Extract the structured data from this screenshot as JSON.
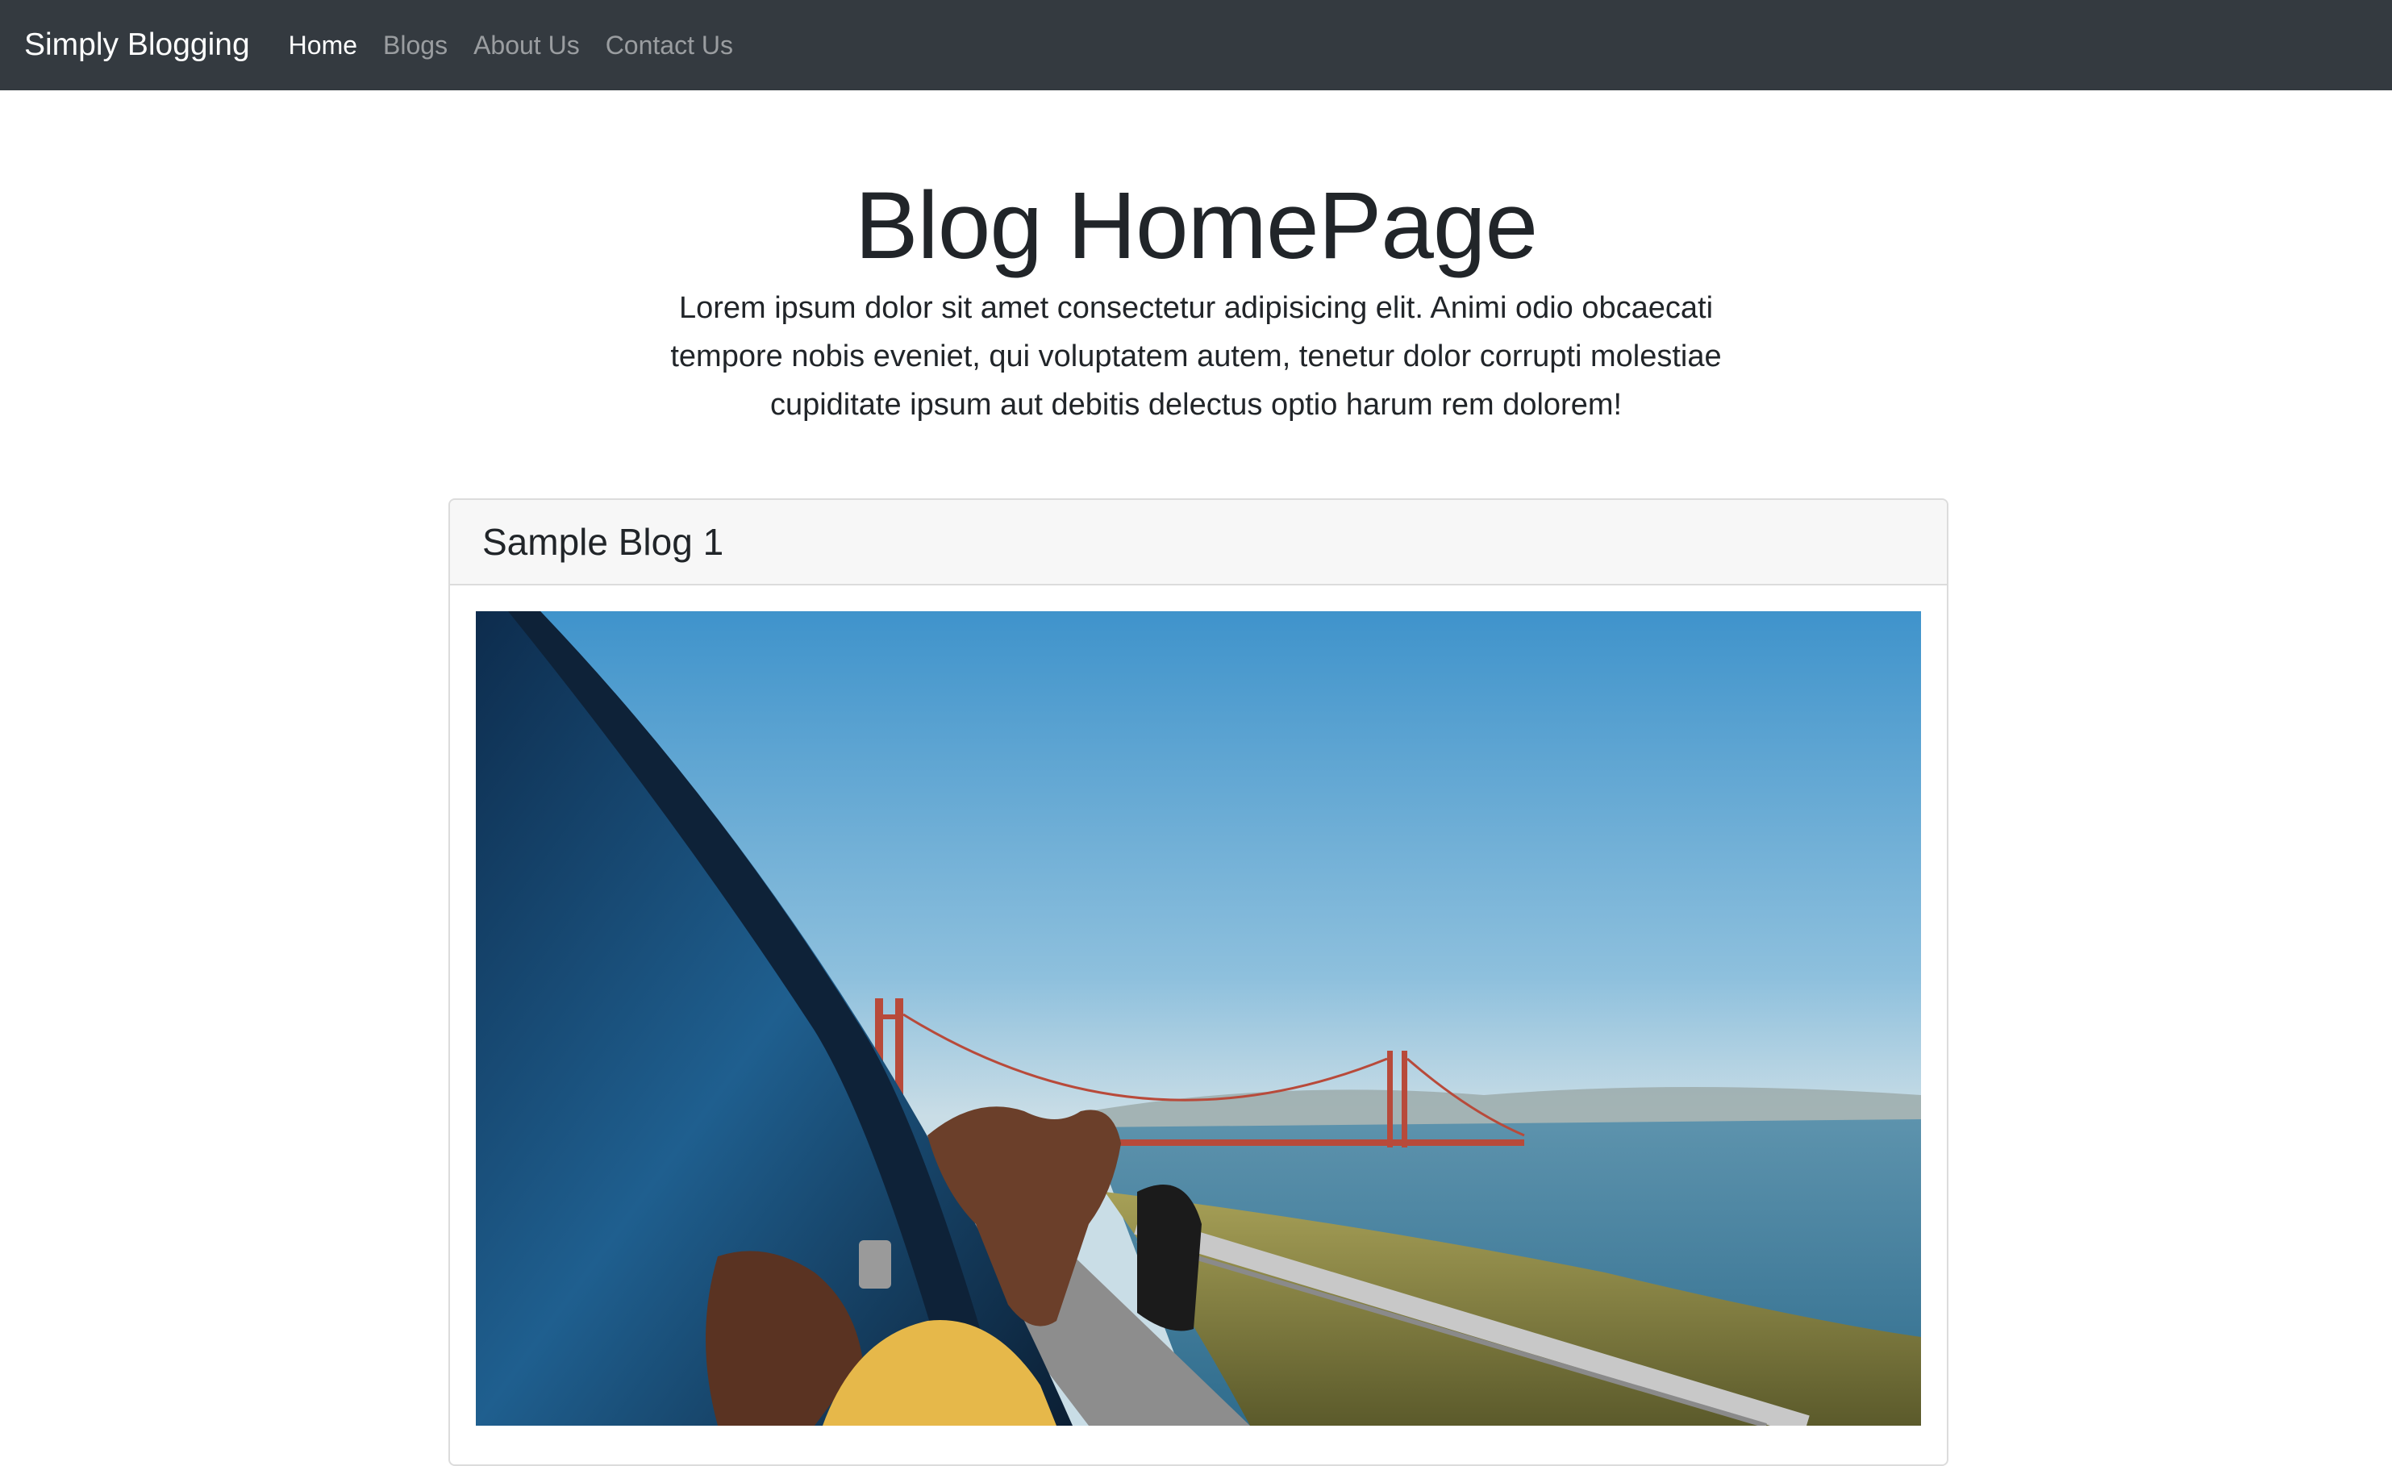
{
  "navbar": {
    "brand": "Simply Blogging",
    "links": [
      {
        "label": "Home",
        "active": true
      },
      {
        "label": "Blogs",
        "active": false
      },
      {
        "label": "About Us",
        "active": false
      },
      {
        "label": "Contact Us",
        "active": false
      }
    ]
  },
  "hero": {
    "title": "Blog HomePage",
    "lead": "Lorem ipsum dolor sit amet consectetur adipisicing elit. Animi odio obcaecati tempore nobis eveniet, qui voluptatem autem, tenetur dolor corrupti molestiae cupiditate ipsum aut debitis delectus optio harum rem dolorem!"
  },
  "blog_card": {
    "title": "Sample Blog 1",
    "image": "photo of hands reaching out of a car window with the Golden Gate Bridge and bay in the background"
  },
  "colors": {
    "navbar_bg": "#343a40",
    "card_header_bg": "#f7f7f7",
    "card_border": "#dcdcdc"
  }
}
